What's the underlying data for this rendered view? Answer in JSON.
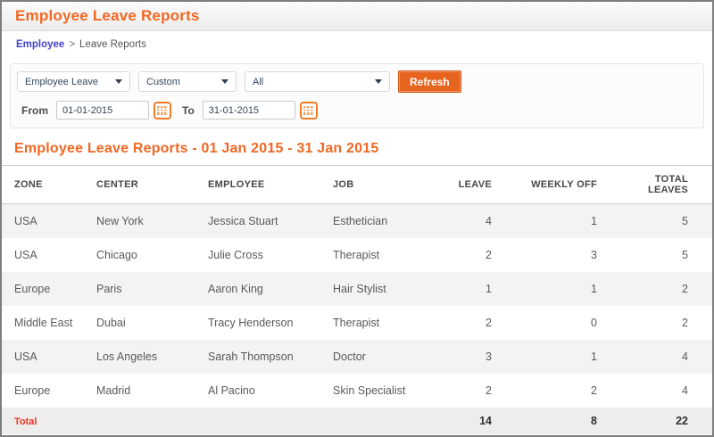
{
  "page": {
    "title": "Employee Leave Reports"
  },
  "breadcrumb": {
    "link": "Employee",
    "separator": ">",
    "current": "Leave Reports"
  },
  "filters": {
    "report_type_selected": "Employee Leave",
    "range_selected": "Custom",
    "scope_selected": "All",
    "refresh_label": "Refresh",
    "from_label": "From",
    "from_value": "01-01-2015",
    "to_label": "To",
    "to_value": "31-01-2015"
  },
  "report": {
    "title": "Employee Leave Reports - 01 Jan 2015 - 31 Jan 2015",
    "columns": [
      "ZONE",
      "CENTER",
      "EMPLOYEE",
      "JOB",
      "LEAVE",
      "WEEKLY OFF",
      "TOTAL LEAVES"
    ],
    "rows": [
      {
        "zone": "USA",
        "center": "New York",
        "employee": "Jessica Stuart",
        "job": "Esthetician",
        "leave": "4",
        "weekly_off": "1",
        "total_leaves": "5"
      },
      {
        "zone": "USA",
        "center": "Chicago",
        "employee": "Julie Cross",
        "job": "Therapist",
        "leave": "2",
        "weekly_off": "3",
        "total_leaves": "5"
      },
      {
        "zone": "Europe",
        "center": "Paris",
        "employee": "Aaron King",
        "job": "Hair Stylist",
        "leave": "1",
        "weekly_off": "1",
        "total_leaves": "2"
      },
      {
        "zone": "Middle East",
        "center": "Dubai",
        "employee": "Tracy Henderson",
        "job": "Therapist",
        "leave": "2",
        "weekly_off": "0",
        "total_leaves": "2"
      },
      {
        "zone": "USA",
        "center": "Los Angeles",
        "employee": "Sarah Thompson",
        "job": "Doctor",
        "leave": "3",
        "weekly_off": "1",
        "total_leaves": "4"
      },
      {
        "zone": "Europe",
        "center": "Madrid",
        "employee": "Al Pacino",
        "job": "Skin Specialist",
        "leave": "2",
        "weekly_off": "2",
        "total_leaves": "4"
      }
    ],
    "total": {
      "label": "Total",
      "leave": "14",
      "weekly_off": "8",
      "total_leaves": "22"
    }
  },
  "colors": {
    "accent_orange": "#f26722",
    "button_orange": "#e7641e",
    "total_label_red": "#ee3322",
    "breadcrumb_link_blue": "#4343d0"
  }
}
